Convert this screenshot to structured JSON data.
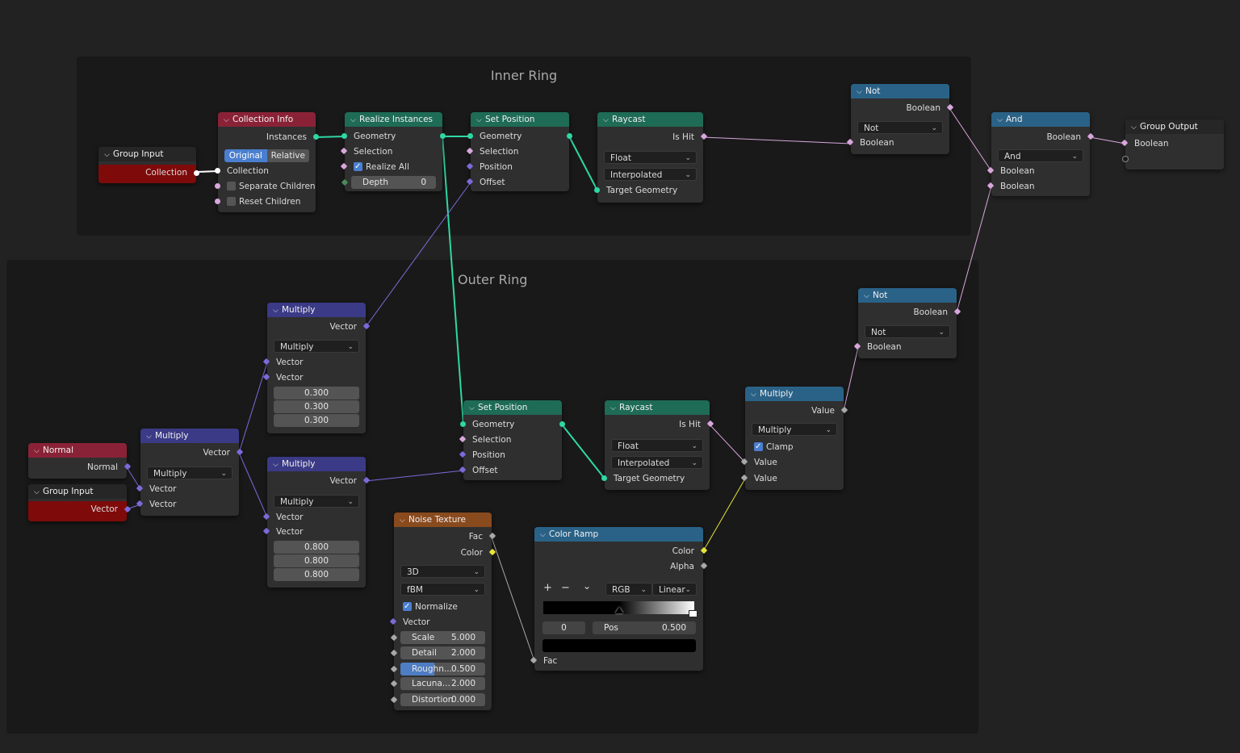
{
  "frames": {
    "inner_title": "Inner Ring",
    "outer_title": "Outer Ring"
  },
  "nodes": {
    "group_input_1": {
      "title": "Group Input",
      "collection": "Collection"
    },
    "collection_info": {
      "title": "Collection Info",
      "instances": "Instances",
      "mode_original": "Original",
      "mode_relative": "Relative",
      "collection": "Collection",
      "separate_children": "Separate Children",
      "reset_children": "Reset Children"
    },
    "realize_instances": {
      "title": "Realize Instances",
      "geometry": "Geometry",
      "selection": "Selection",
      "realize_all": "Realize All",
      "depth_label": "Depth",
      "depth_value": "0"
    },
    "set_position_1": {
      "title": "Set Position",
      "geometry": "Geometry",
      "selection": "Selection",
      "position": "Position",
      "offset": "Offset"
    },
    "raycast_1": {
      "title": "Raycast",
      "is_hit": "Is Hit",
      "data_type": "Float",
      "mapping": "Interpolated",
      "target_geometry": "Target Geometry"
    },
    "not_1": {
      "title": "Not",
      "out": "Boolean",
      "op": "Not",
      "in": "Boolean"
    },
    "and_node": {
      "title": "And",
      "out": "Boolean",
      "op": "And",
      "in1": "Boolean",
      "in2": "Boolean"
    },
    "group_output": {
      "title": "Group Output",
      "in": "Boolean"
    },
    "not_2": {
      "title": "Not",
      "out": "Boolean",
      "op": "Not",
      "in": "Boolean"
    },
    "multiply_top": {
      "title": "Multiply",
      "out": "Vector",
      "op": "Multiply",
      "in1": "Vector",
      "in2": "Vector",
      "x": "0.300",
      "y": "0.300",
      "z": "0.300"
    },
    "multiply_mid": {
      "title": "Multiply",
      "out": "Vector",
      "op": "Multiply",
      "in1": "Vector",
      "in2": "Vector"
    },
    "multiply_bot": {
      "title": "Multiply",
      "out": "Vector",
      "op": "Multiply",
      "in1": "Vector",
      "in2": "Vector",
      "x": "0.800",
      "y": "0.800",
      "z": "0.800"
    },
    "normal": {
      "title": "Normal",
      "out": "Normal"
    },
    "group_input_2": {
      "title": "Group Input",
      "out": "Vector"
    },
    "set_position_2": {
      "title": "Set Position",
      "geometry": "Geometry",
      "selection": "Selection",
      "position": "Position",
      "offset": "Offset"
    },
    "raycast_2": {
      "title": "Raycast",
      "is_hit": "Is Hit",
      "data_type": "Float",
      "mapping": "Interpolated",
      "target_geometry": "Target Geometry"
    },
    "multiply_math": {
      "title": "Multiply",
      "out": "Value",
      "op": "Multiply",
      "clamp": "Clamp",
      "in1": "Value",
      "in2": "Value"
    },
    "noise_texture": {
      "title": "Noise Texture",
      "fac": "Fac",
      "color": "Color",
      "dims": "3D",
      "type": "fBM",
      "normalize": "Normalize",
      "vector": "Vector",
      "scale_label": "Scale",
      "scale": "5.000",
      "detail_label": "Detail",
      "detail": "2.000",
      "rough_label": "Roughn...",
      "rough": "0.500",
      "lac_label": "Lacuna...",
      "lac": "2.000",
      "dist_label": "Distortion",
      "dist": "0.000"
    },
    "color_ramp": {
      "title": "Color Ramp",
      "color": "Color",
      "alpha": "Alpha",
      "add": "+",
      "remove": "−",
      "menu": "⌄",
      "color_mode": "RGB",
      "interp": "Linear",
      "index": "0",
      "pos_label": "Pos",
      "pos": "0.500",
      "fac": "Fac"
    }
  },
  "colors": {
    "geometry": "#2fd7a4",
    "boolean": "#d9a6dc",
    "vector": "#7b6ad9",
    "float": "#a8a8a8",
    "color": "#e6e33c"
  }
}
